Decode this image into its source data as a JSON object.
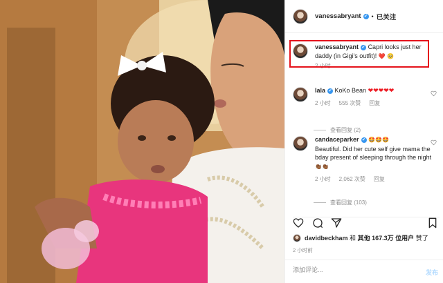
{
  "header": {
    "username": "vanessabryant",
    "verified_badge": "✔",
    "separator": "•",
    "follow_status": "已关注"
  },
  "caption": {
    "username": "vanessabryant",
    "text": "Capri looks just her daddy (in Gigi's outfit)!",
    "emojis": "❤️ 🥺",
    "time": "2 小时"
  },
  "comments": [
    {
      "username": "lala",
      "text": "KoKo Bean",
      "emojis": "❤❤❤❤❤",
      "time": "2 小时",
      "likes": "555 次赞",
      "reply": "回复",
      "view_replies": "查看回复 (2)"
    },
    {
      "username": "candaceparker",
      "emojis": "🤩🤩🤩",
      "text": "Beautiful. Did her cute self give mama the bday present of sleeping through the night",
      "trailing_emojis": "👏🏾👏🏾",
      "time": "2 小时",
      "likes": "2,062 次赞",
      "reply": "回复",
      "view_replies": "查看回复 (103)"
    }
  ],
  "likes_line": {
    "liker": "davidbeckham",
    "connector": "和",
    "others_prefix": "其他",
    "count": "167.3万",
    "users_suffix": "位用户",
    "liked": "赞了"
  },
  "post_time": "2 小时前",
  "add_comment": {
    "placeholder": "添加评论...",
    "post_label": "发布"
  },
  "icons": {
    "like": "heart-outline-icon",
    "comment": "comment-bubble-icon",
    "share": "paper-plane-icon",
    "save": "bookmark-icon"
  },
  "colors": {
    "highlight_box": "#e5121b",
    "verified": "#3897f0",
    "heart": "#ed1c24",
    "muted": "#8e8e8e",
    "post_button": "#b3dbff"
  }
}
